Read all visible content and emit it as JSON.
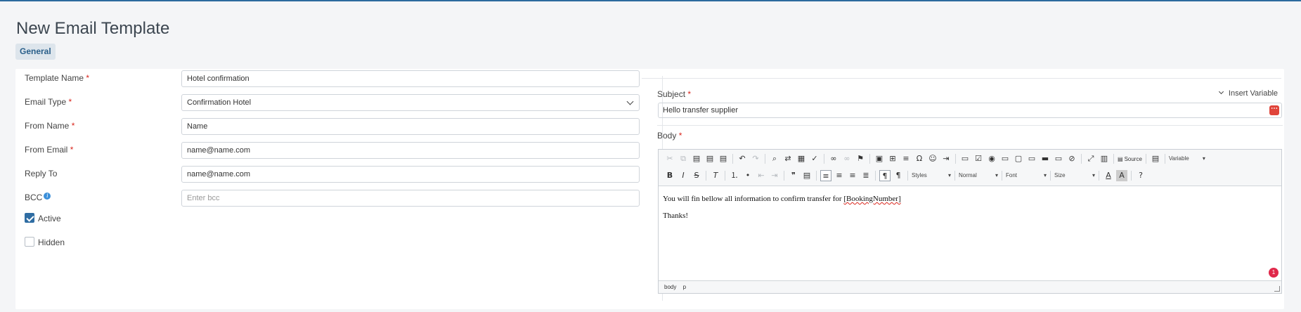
{
  "page": {
    "title": "New Email Template"
  },
  "tabs": [
    {
      "label": "General"
    }
  ],
  "form": {
    "template_name": {
      "label": "Template Name",
      "required": "*",
      "value": "Hotel confirmation"
    },
    "email_type": {
      "label": "Email Type",
      "required": "*",
      "value": "Confirmation Hotel"
    },
    "from_name": {
      "label": "From Name",
      "required": "*",
      "value": "Name"
    },
    "from_email": {
      "label": "From Email",
      "required": "*",
      "value": "name@name.com"
    },
    "reply_to": {
      "label": "Reply To",
      "value": "name@name.com"
    },
    "bcc": {
      "label": "BCC",
      "placeholder": "Enter bcc"
    },
    "active": {
      "label": "Active",
      "checked": true
    },
    "hidden": {
      "label": "Hidden",
      "checked": false
    }
  },
  "subject": {
    "label": "Subject",
    "required": "*",
    "value": "Hello transfer supplier",
    "insert_variable": "Insert Variable"
  },
  "body": {
    "label": "Body",
    "required": "*",
    "toolbar": {
      "source_label": "Source",
      "variable_label": "Variable",
      "styles_label": "Styles",
      "format_label": "Normal",
      "font_label": "Font",
      "size_label": "Size"
    },
    "content": {
      "line1_prefix": "You will fin bellow all information to confirm transfer for ",
      "line1_variable": "[BookingNumber]",
      "line2": "Thanks!"
    },
    "badge_count": "1",
    "status_path": [
      "body",
      "p"
    ]
  },
  "colors": {
    "accent": "#2f6da3",
    "required": "#d9251c",
    "badge": "#e0284a"
  }
}
